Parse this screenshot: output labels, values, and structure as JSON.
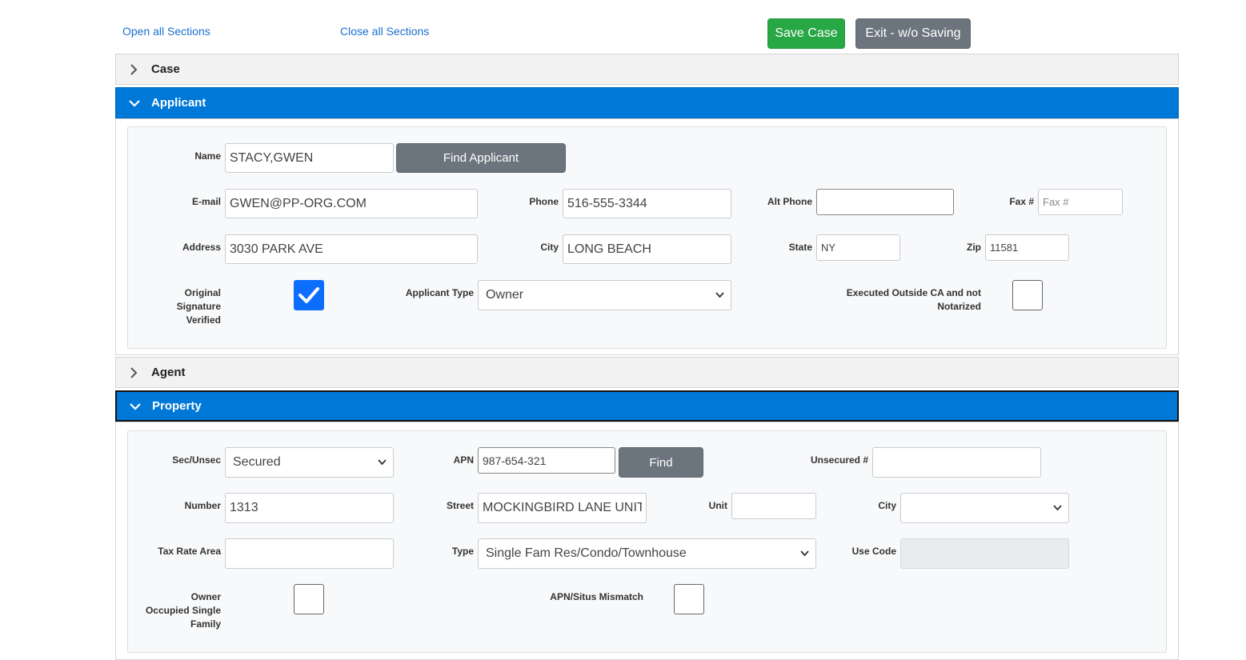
{
  "toolbar": {
    "open_all": "Open all Sections",
    "close_all": "Close all Sections",
    "save": "Save Case",
    "exit": "Exit - w/o Saving"
  },
  "sections": {
    "case": "Case",
    "applicant": "Applicant",
    "agent": "Agent",
    "property": "Property"
  },
  "applicant": {
    "name_label": "Name",
    "name_value": "STACY,GWEN",
    "find_button": "Find Applicant",
    "email_label": "E-mail",
    "email_value": "GWEN@PP-ORG.COM",
    "phone_label": "Phone",
    "phone_value": "516-555-3344",
    "alt_phone_label": "Alt Phone",
    "alt_phone_value": "",
    "fax_label": "Fax #",
    "fax_placeholder": "Fax #",
    "address_label": "Address",
    "address_value": "3030 PARK AVE",
    "city_label": "City",
    "city_value": "LONG BEACH",
    "state_label": "State",
    "state_value": "NY",
    "zip_label": "Zip",
    "zip_value": "11581",
    "orig_sig_label_1": "Original",
    "orig_sig_label_2": "Signature",
    "orig_sig_label_3": "Verified",
    "orig_sig_checked": true,
    "type_label": "Applicant Type",
    "type_value": "Owner",
    "executed_label_1": "Executed Outside CA and not",
    "executed_label_2": "Notarized",
    "executed_checked": false
  },
  "property": {
    "secunsec_label": "Sec/Unsec",
    "secunsec_value": "Secured",
    "apn_label": "APN",
    "apn_value": "987-654-321",
    "find_button": "Find",
    "unsecured_label": "Unsecured #",
    "unsecured_value": "",
    "number_label": "Number",
    "number_value": "1313",
    "street_label": "Street",
    "street_value": "MOCKINGBIRD LANE UNIT",
    "unit_label": "Unit",
    "unit_value": "",
    "city_label": "City",
    "city_value": "",
    "tra_label": "Tax Rate Area",
    "tra_value": "",
    "type_label": "Type",
    "type_value": "Single Fam Res/Condo/Townhouse",
    "use_code_label": "Use Code",
    "owner_occ_label_1": "Owner",
    "owner_occ_label_2": "Occupied Single",
    "owner_occ_label_3": "Family",
    "owner_occ_checked": false,
    "mismatch_label": "APN/Situs Mismatch",
    "mismatch_checked": false
  },
  "icons": {
    "chevron_right": "chevron-right-icon",
    "chevron_down": "chevron-down-icon",
    "check": "check-icon",
    "select_caret": "select-caret-icon"
  },
  "colors": {
    "section_open": "#0078d7",
    "save_button": "#28a745",
    "exit_button": "#6c757d",
    "link": "#1a6fd0",
    "checkbox_on": "#0d6efd"
  }
}
